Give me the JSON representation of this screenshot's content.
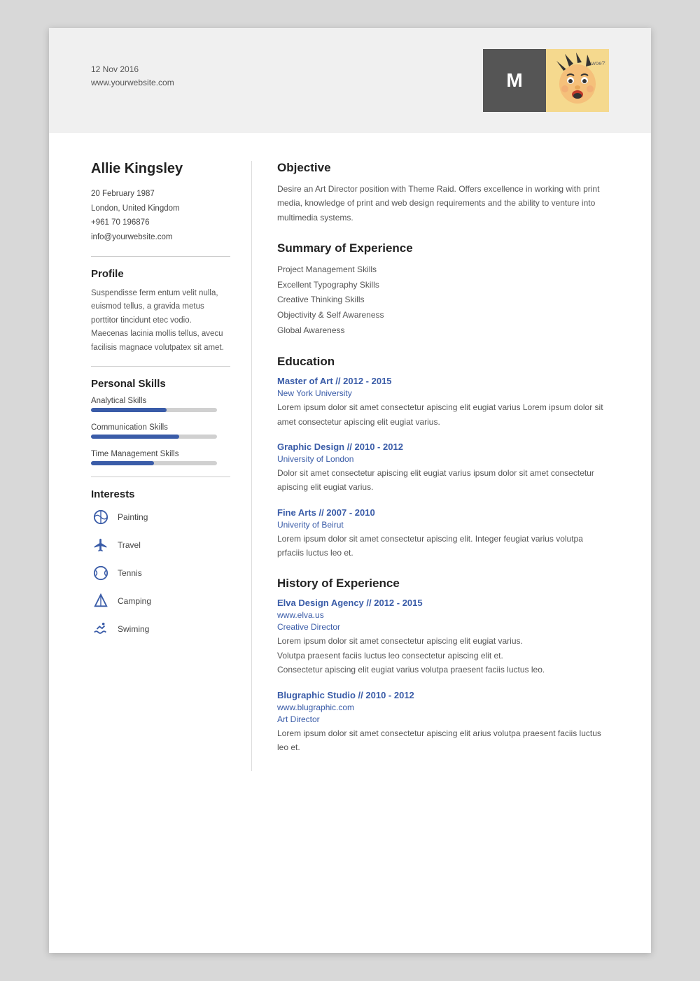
{
  "header": {
    "date": "12 Nov 2016",
    "website": "www.yourwebsite.com",
    "avatar_letter": "M",
    "avatar_alt": "Cartoon avatar"
  },
  "left": {
    "name": "Allie Kingsley",
    "contact": {
      "dob": "20 February 1987",
      "location": "London, United Kingdom",
      "phone": "+961 70 196876",
      "email": "info@yourwebsite.com"
    },
    "profile_title": "Profile",
    "profile_text": "Suspendisse ferm entum velit nulla, euismod tellus, a gravida metus porttitor tincidunt etec vodio. Maecenas lacinia mollis tellus, avecu facilisis magnace volutpatex sit amet.",
    "skills_title": "Personal Skills",
    "skills": [
      {
        "name": "Analytical Skills",
        "pct": 60
      },
      {
        "name": "Communication Skills",
        "pct": 70
      },
      {
        "name": "Time Management Skills",
        "pct": 50
      }
    ],
    "interests_title": "Interests",
    "interests": [
      {
        "label": "Painting",
        "icon": "🌐"
      },
      {
        "label": "Travel",
        "icon": "✈"
      },
      {
        "label": "Tennis",
        "icon": "🎾"
      },
      {
        "label": "Camping",
        "icon": "⛺"
      },
      {
        "label": "Swiming",
        "icon": "🏊"
      }
    ]
  },
  "right": {
    "objective_title": "Objective",
    "objective_text": "Desire an Art Director position with Theme Raid. Offers excellence in working with print media, knowledge of print and web design requirements and the ability to venture into multimedia systems.",
    "summary_title": "Summary of Experience",
    "summary_items": [
      "Project Management Skills",
      "Excellent Typography Skills",
      "Creative Thinking Skills",
      "Objectivity & Self Awareness",
      "Global Awareness"
    ],
    "education_title": "Education",
    "education": [
      {
        "title": "Master of Art // 2012 - 2015",
        "school": "New York University",
        "desc": "Lorem ipsum dolor sit amet consectetur apiscing elit eugiat varius Lorem ipsum dolor sit amet consectetur apiscing elit eugiat varius."
      },
      {
        "title": "Graphic Design // 2010 - 2012",
        "school": "University of London",
        "desc": "Dolor sit amet consectetur apiscing elit eugiat varius  ipsum dolor sit amet consectetur apiscing elit eugiat varius."
      },
      {
        "title": "Fine Arts // 2007 - 2010",
        "school": "Univerity of Beirut",
        "desc": "Lorem ipsum dolor sit amet consectetur apiscing elit. Integer feugiat varius volutpa prfaciis luctus leo et."
      }
    ],
    "history_title": "History of Experience",
    "history": [
      {
        "title": "Elva Design Agency // 2012 - 2015",
        "company": "www.elva.us",
        "role": "Creative Director",
        "desc": "Lorem ipsum dolor sit amet consectetur apiscing elit eugiat varius.\nVolutpa praesent faciis luctus leo consectetur apiscing elit et.\nConsecttur apiscing elit eugiat varius volutpa praesent faciis luctus leo."
      },
      {
        "title": "Blugraphic Studio // 2010 - 2012",
        "company": "www.blugraphic.com",
        "role": "Art Director",
        "desc": "Lorem ipsum dolor sit amet consectetur apiscing elit arius volutpa praesent faciis luctus leo et."
      }
    ]
  }
}
